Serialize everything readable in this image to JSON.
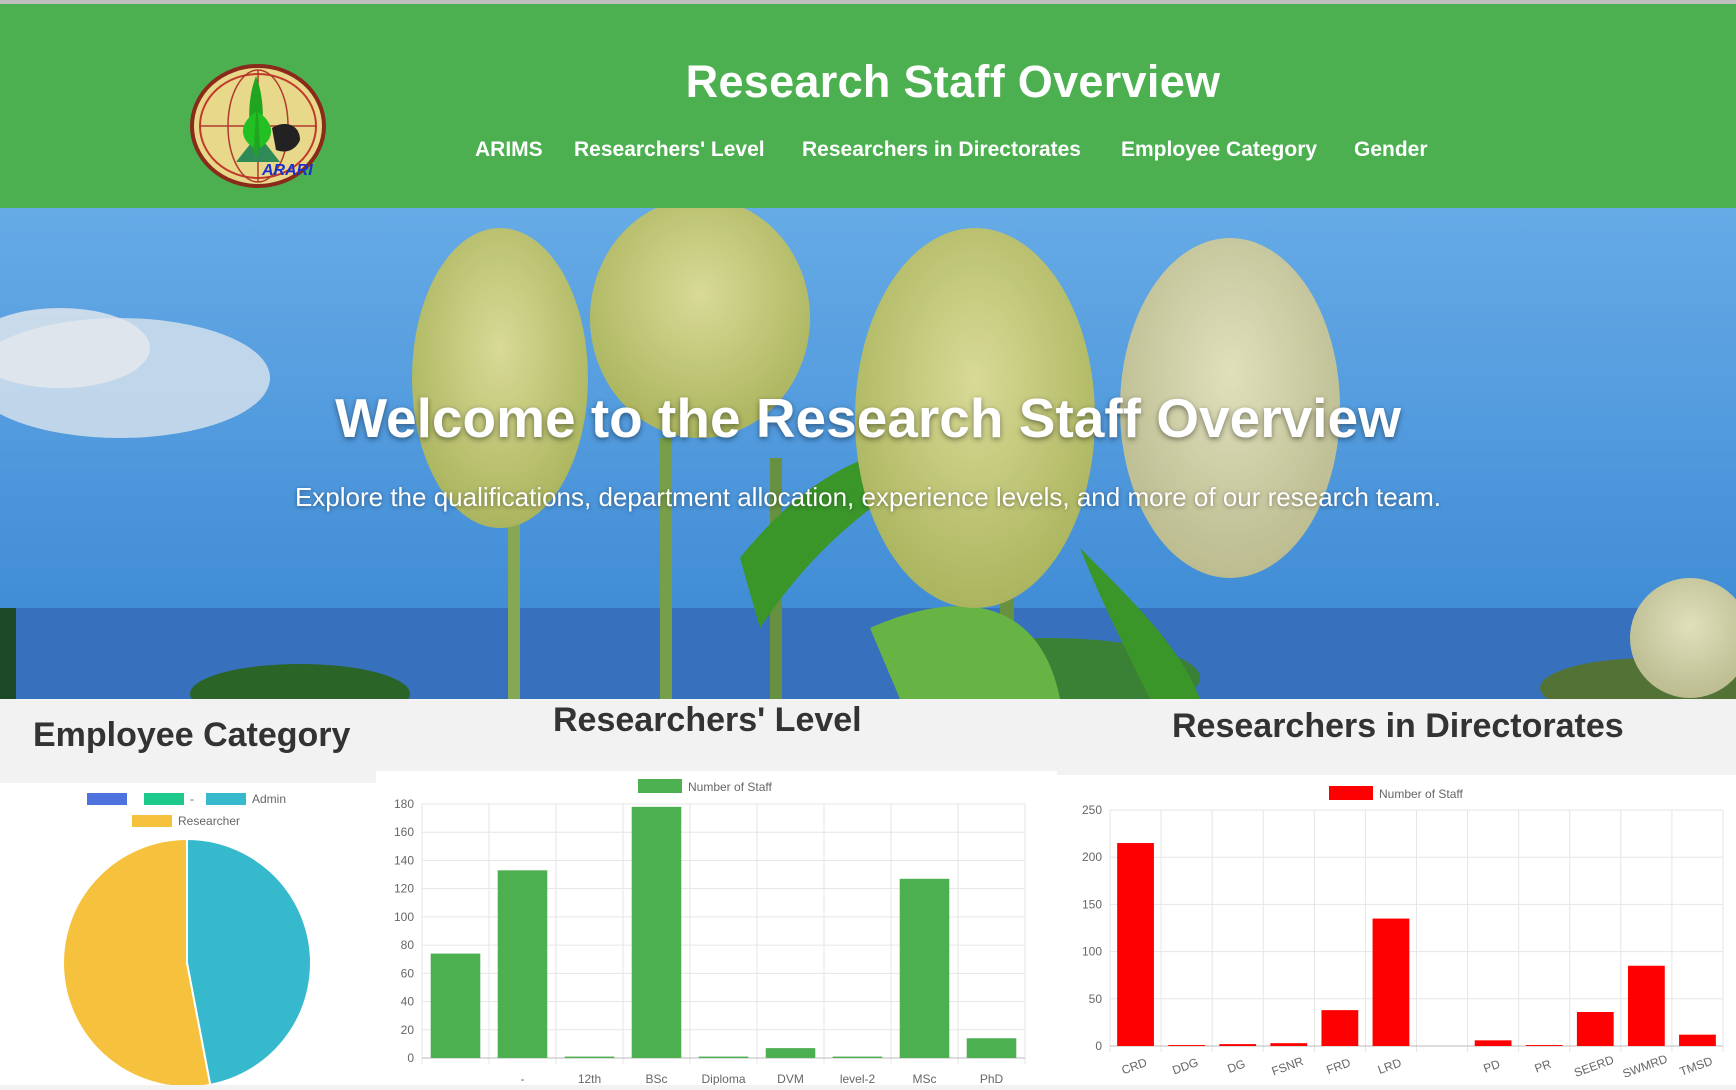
{
  "header": {
    "title": "Research Staff Overview",
    "nav": [
      {
        "label": "ARIMS"
      },
      {
        "label": "Researchers' Level"
      },
      {
        "label": "Researchers in Directorates"
      },
      {
        "label": "Employee Category"
      },
      {
        "label": "Gender"
      }
    ],
    "logo_text": "ARARI"
  },
  "hero": {
    "title": "Welcome to the Research Staff Overview",
    "subtitle": "Explore the qualifications, department allocation, experience levels, and more of our research team."
  },
  "sections": {
    "employee_category": "Employee Category",
    "researchers_level": "Researchers' Level",
    "directorates": "Researchers in Directorates"
  },
  "colors": {
    "brand_green": "#4caf50",
    "bar_green": "#4caf50",
    "bar_red": "#ff0000",
    "pie_blue": "#4e73df",
    "pie_green": "#1cc88a",
    "pie_teal": "#36b9cc",
    "pie_yellow": "#f6c23e"
  },
  "chart_data": [
    {
      "type": "pie",
      "title": "",
      "labels": [
        "",
        "-",
        "Admin",
        "Researcher"
      ],
      "values": [
        0,
        0,
        47,
        53
      ],
      "colors": [
        "#4e73df",
        "#1cc88a",
        "#36b9cc",
        "#f6c23e"
      ],
      "legend": "top"
    },
    {
      "type": "bar",
      "title": "",
      "categories": [
        "",
        "-",
        "12th",
        "BSc",
        "Diploma",
        "DVM",
        "level-2",
        "MSc",
        "PhD"
      ],
      "series": [
        {
          "name": "Number of Staff",
          "values": [
            74,
            133,
            1,
            178,
            1,
            7,
            1,
            127,
            14
          ]
        }
      ],
      "ylim": [
        0,
        180
      ],
      "yticks": [
        0,
        20,
        40,
        60,
        80,
        100,
        120,
        140,
        160,
        180
      ],
      "legend": "top",
      "grid": true
    },
    {
      "type": "bar",
      "title": "",
      "categories": [
        "CRD",
        "DDG",
        "DG",
        "FSNR",
        "FRD",
        "LRD",
        "",
        "PD",
        "PR",
        "SEERD",
        "SWMRD",
        "TMSD"
      ],
      "series": [
        {
          "name": "Number of Staff",
          "values": [
            215,
            1,
            2,
            3,
            38,
            135,
            0,
            6,
            1,
            36,
            85,
            12
          ]
        }
      ],
      "ylim": [
        0,
        250
      ],
      "yticks": [
        0,
        50,
        100,
        150,
        200,
        250
      ],
      "legend": "top",
      "grid": true
    }
  ]
}
